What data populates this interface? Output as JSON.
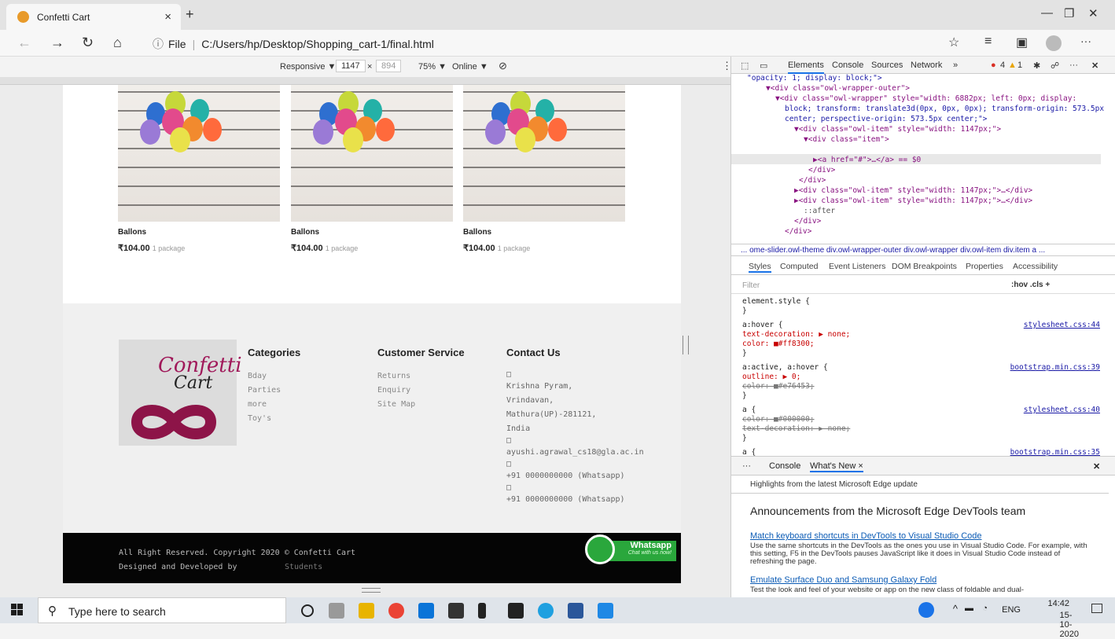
{
  "browser": {
    "tab_title": "Confetti Cart",
    "tab_close": "×",
    "new_tab": "+",
    "url_prefix": "File",
    "url": "C:/Users/hp/Desktop/Shopping_cart-1/final.html",
    "win_min": "—",
    "win_max": "❐",
    "win_close": "✕",
    "nav_back": "←",
    "nav_forward": "→",
    "nav_refresh": "↻",
    "nav_home": "⌂",
    "more": "···"
  },
  "device_toolbar": {
    "mode": "Responsive ▼",
    "width": "1147",
    "times": "×",
    "height": "894",
    "zoom": "75% ▼",
    "network": "Online ▼",
    "rotate": "⃠",
    "menu": "⋮"
  },
  "products": [
    {
      "name": "Ballons",
      "price": "₹104.00",
      "unit": "1 package"
    },
    {
      "name": "Ballons",
      "price": "₹104.00",
      "unit": "1 package"
    },
    {
      "name": "Ballons",
      "price": "₹104.00",
      "unit": "1 package"
    }
  ],
  "footer": {
    "logo_line1": "Confetti",
    "logo_line2": "Cart",
    "categories": {
      "title": "Categories",
      "items": [
        "Bday",
        "Parties",
        "more",
        "Toy's"
      ]
    },
    "customer_service": {
      "title": "Customer Service",
      "items": [
        "Returns",
        "Enquiry",
        "Site Map"
      ]
    },
    "contact": {
      "title": "Contact Us",
      "glyph": "□",
      "addr1": "Krishna Pyram,",
      "addr2": "Vrindavan,",
      "addr3": "Mathura(UP)-281121,",
      "addr4": "India",
      "email": "ayushi.agrawal_cs18@gla.ac.in",
      "phone1": "+91 0000000000 (Whatsapp)",
      "phone2": "+91 0000000000 (Whatsapp)"
    },
    "copyright": "All Right Reserved. Copyright  2020 © Confetti Cart",
    "designed_by": "Designed and Developed by",
    "designed_by_name": "Students",
    "whatsapp_label": "Whatsapp",
    "whatsapp_sub": "Chat with us now!"
  },
  "devtools": {
    "tabs": [
      "Elements",
      "Console",
      "Sources",
      "Network",
      "»"
    ],
    "errors": "4",
    "warnings": "1",
    "dom_lines": [
      "\"opacity: 1; display: block;\">",
      "▼<div class=\"owl-wrapper-outer\">",
      "▼<div class=\"owl-wrapper\" style=\"width: 6882px; left: 0px; display:",
      "block; transform: translate3d(0px, 0px, 0px); transform-origin: 573.5px",
      "center; perspective-origin: 573.5px center;\">",
      "▼<div class=\"owl-item\" style=\"width: 1147px;\">",
      "▼<div class=\"item\">",
      "▶<a href=\"#\">…</a> == $0",
      "</div>",
      "</div>",
      "▶<div class=\"owl-item\" style=\"width: 1147px;\">…</div>",
      "▶<div class=\"owl-item\" style=\"width: 1147px;\">…</div>",
      "::after",
      "</div>",
      "</div>"
    ],
    "breadcrumb": "... ome-slider.owl-theme  div.owl-wrapper-outer  div.owl-wrapper  div.owl-item  div.item  a  ...",
    "style_tabs": [
      "Styles",
      "Computed",
      "Event Listeners",
      "DOM Breakpoints",
      "Properties",
      "Accessibility"
    ],
    "filter_placeholder": "Filter",
    "filter_tools": ":hov  .cls  +",
    "rules": [
      {
        "sel": "element.style {",
        "src": ""
      },
      {
        "sel": "}",
        "src": ""
      },
      {
        "sel": "a:hover {",
        "src": "stylesheet.css:44"
      },
      {
        "sel": "  text-decoration: ▶ none;",
        "src": ""
      },
      {
        "sel": "  color: ■#ff8300;",
        "src": ""
      },
      {
        "sel": "}",
        "src": ""
      },
      {
        "sel": "a:active, a:hover {",
        "src": "bootstrap.min.css:39"
      },
      {
        "sel": "  outline: ▶ 0;",
        "src": ""
      },
      {
        "sel": "  color: ■#e76453;",
        "src": ""
      },
      {
        "sel": "}",
        "src": ""
      },
      {
        "sel": "a {",
        "src": "stylesheet.css:40"
      },
      {
        "sel": "  color: ■#000000;",
        "src": ""
      },
      {
        "sel": "  text-decoration: ▶ none;",
        "src": ""
      },
      {
        "sel": "}",
        "src": ""
      },
      {
        "sel": "a {",
        "src": "bootstrap.min.css:35"
      }
    ],
    "drawer_tabs": [
      "Console",
      "What's New ×"
    ],
    "whats_new_header": "Highlights from the latest Microsoft Edge update",
    "announce_title": "Announcements from the Microsoft Edge DevTools team",
    "item1_title": "Match keyboard shortcuts in DevTools to Visual Studio Code",
    "item1_text": "Use the same shortcuts in the DevTools as the ones you use in Visual Studio Code. For example, with this setting, F5 in the DevTools pauses JavaScript like it does in Visual Studio Code instead of refreshing the page.",
    "item2_title": "Emulate Surface Duo and Samsung Galaxy Fold",
    "item2_text": "Test the look and feel of your website or app on the new class of foldable and dual-"
  },
  "taskbar": {
    "search_placeholder": "Type here to search",
    "lang": "ENG",
    "time": "14:42",
    "date": "15-10-2020"
  },
  "colors": {
    "accent_orange": "#ff8300",
    "whatsapp_green": "#2aa73c",
    "footer_black": "#050505"
  }
}
